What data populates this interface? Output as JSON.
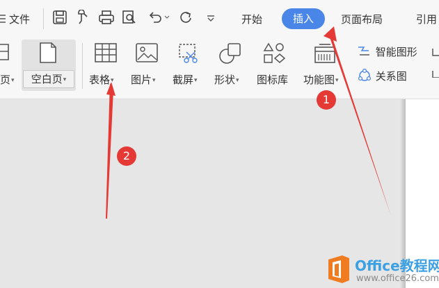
{
  "menu": {
    "file_label": "文件"
  },
  "tabs": [
    {
      "label": "开始"
    },
    {
      "label": "插入"
    },
    {
      "label": "页面布局"
    },
    {
      "label": "引用"
    }
  ],
  "ribbon": {
    "page_label_partial": "页",
    "blank_page_label": "空白页",
    "items": [
      {
        "label": "表格",
        "icon": "table-icon"
      },
      {
        "label": "图片",
        "icon": "picture-icon"
      },
      {
        "label": "截屏",
        "icon": "screenshot-icon"
      },
      {
        "label": "形状",
        "icon": "shapes-icon"
      },
      {
        "label": "图标库",
        "icon": "icon-library-icon"
      },
      {
        "label": "功能图",
        "icon": "function-chart-icon"
      }
    ],
    "smart_graphic_label": "智能图形",
    "relation_chart_label": "关系图"
  },
  "annotations": {
    "marker1": "1",
    "marker2": "2",
    "color": "#e53935"
  },
  "watermark": {
    "brand": "Office教程网",
    "url": "www.office26.com",
    "logo_color": "#f07c22"
  },
  "colors": {
    "accent": "#4a86e8",
    "background": "#e6e6e6",
    "toolbar": "#f7f7f7"
  }
}
